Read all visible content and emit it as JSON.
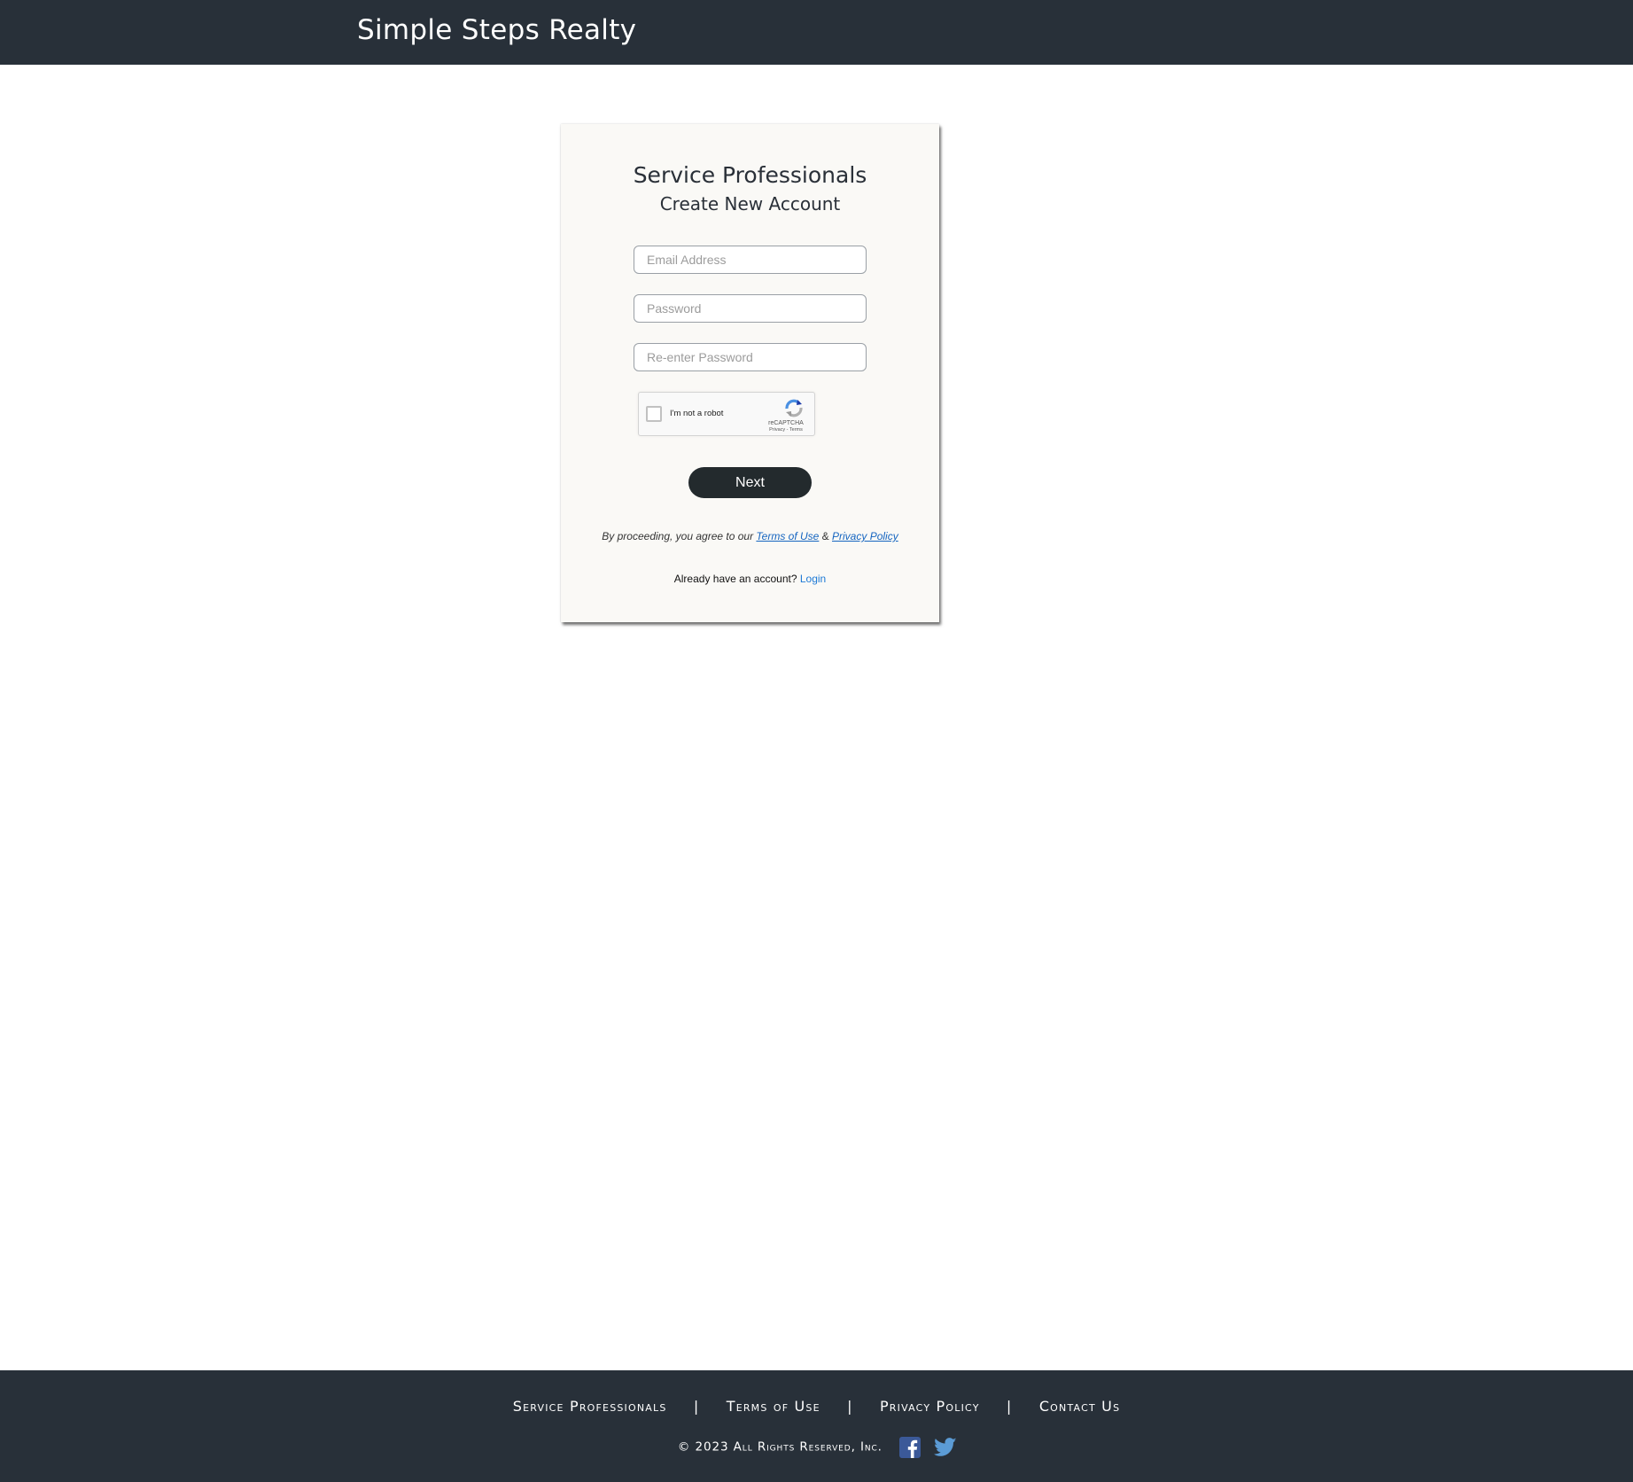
{
  "header": {
    "brand": "Simple Steps Realty"
  },
  "signup": {
    "title": "Service Professionals",
    "subtitle": "Create New Account",
    "email_placeholder": "Email Address",
    "password_placeholder": "Password",
    "reenter_placeholder": "Re-enter Password",
    "captcha": {
      "label": "I'm not a robot",
      "brand": "reCAPTCHA",
      "links": "Privacy - Terms",
      "checked": false
    },
    "next_label": "Next",
    "terms": {
      "lead": "By proceeding, you agree to our ",
      "terms_link": "Terms of Use",
      "joiner": " & ",
      "privacy_link": "Privacy Policy"
    },
    "account": {
      "prompt": "Already have an account? ",
      "login_link": "Login"
    }
  },
  "footer": {
    "links": [
      "Service Professionals",
      "Terms of Use",
      "Privacy Policy",
      "Contact Us"
    ],
    "separator": "|",
    "copyright": "© 2023 All Rights Reserved, Inc.",
    "social": [
      "facebook-icon",
      "twitter-icon"
    ]
  },
  "colors": {
    "bar": "#283039",
    "card": "#faf9f6",
    "button": "#232a2d",
    "link": "#1565c0",
    "facebook": "#3b5998",
    "twitter": "#5b9bd5"
  }
}
